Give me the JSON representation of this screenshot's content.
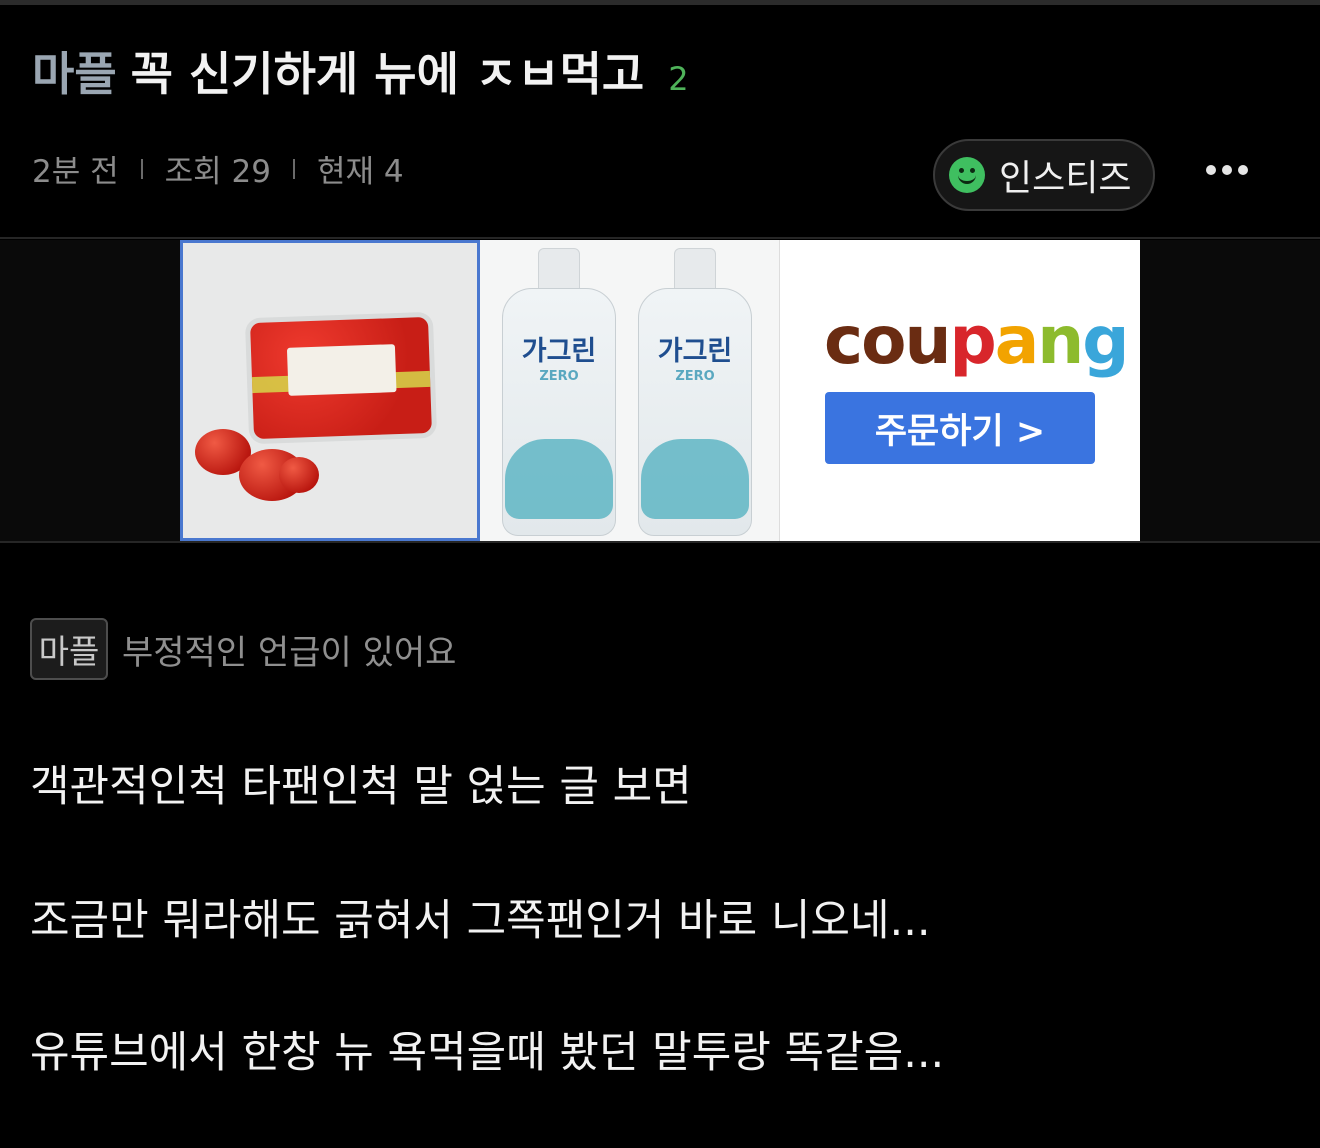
{
  "post": {
    "category": "마플",
    "title": "꼭 신기하게 뉴에 ㅈㅂ먹고",
    "comment_count": "2",
    "meta": {
      "time": "2분 전",
      "views": "조회 29",
      "current": "현재 4"
    },
    "board_badge": "인스티즈",
    "more_icon": "more-horizontal-icon"
  },
  "ad": {
    "products": [
      {
        "name": "tomato",
        "icon": "tomato-product-image"
      },
      {
        "name": "가그린",
        "sub": "ZERO",
        "icon": "mouthwash-product-image"
      }
    ],
    "brand": {
      "letters": [
        "c",
        "o",
        "u",
        "p",
        "a",
        "n",
        "g"
      ],
      "colors": [
        "#6a2c12",
        "#6a2c12",
        "#6a2c12",
        "#d8262b",
        "#f2a300",
        "#8dbb2d",
        "#3aa6da"
      ]
    },
    "cta": "주문하기 >"
  },
  "notice": {
    "tag": "마플",
    "text": "부정적인 언급이 있어요"
  },
  "body": {
    "lines": [
      "객관적인척 타팬인척 말 얹는 글 보면",
      "조금만 뭐라해도 긁혀서 그쪽팬인거 바로 니오네...",
      "유튜브에서 한창 뉴 욕먹을때 봤던 말투랑 똑같음..."
    ]
  }
}
